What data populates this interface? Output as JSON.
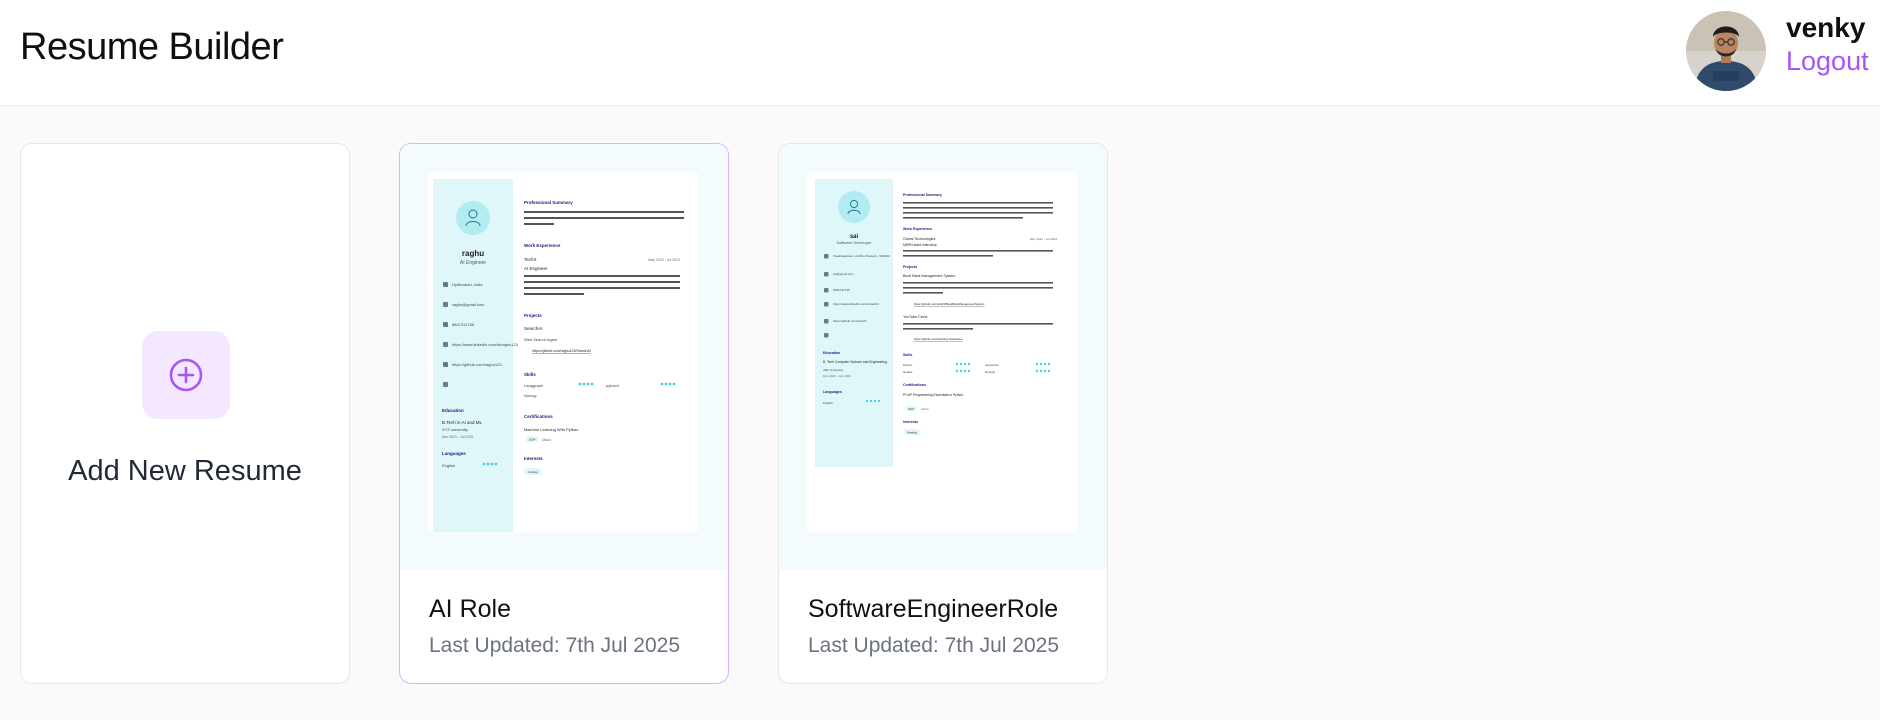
{
  "app": {
    "title": "Resume Builder"
  },
  "user": {
    "name": "venky",
    "logout_label": "Logout",
    "avatar_icon": "user-avatar-photo"
  },
  "add_card": {
    "label": "Add New Resume",
    "icon": "plus-circle-icon"
  },
  "resumes": [
    {
      "title": "AI Role",
      "updated": "Last Updated: 7th Jul 2025",
      "preview": {
        "name": "raghu",
        "role": "AI Engineer",
        "contacts": [
          "Hyderabad, India",
          "raghu@gmail.com",
          "8847311786",
          "https://www.linkedin.com/in/raghu123",
          "https://github.com/raghu123"
        ],
        "summary_heading": "Professional Summary",
        "summary": "AI Developer with hands-on experience in building AI Agents. Completed internships and personal projects demonstrating a strong foundation in AI Developer.",
        "work_heading": "Work Experience",
        "work_company": "TechX",
        "work_dates": "May 2023 - Jul 2023",
        "work_role": "AI Engineer",
        "work_desc": "A Comprehensive TDMs Test Data Management pipeline is created to produce synthetic Tabular Datasets that accurately replicate the characteristics and patterns of real-world data using CTGAN and RealTabFormer libraries",
        "projects_heading": "Projects",
        "project_name": "SearchAI",
        "project_desc": "Web Search Agent",
        "project_link": "https://github.com/raghu123/SearchAI",
        "education_heading": "Education",
        "degree": "B.Tech in AI and ML",
        "school": "XYZ university",
        "edu_dates": "Dec 2021 - Jul 2025",
        "skills_heading": "Skills",
        "skills": [
          "Langgraph",
          "Numpy",
          "pytorch"
        ],
        "languages_heading": "Languages",
        "languages": [
          "English"
        ],
        "cert_heading": "Certifications",
        "cert": "Machine Learning With Python",
        "cert_tag": "2024",
        "cert_org": "Cisco",
        "interests_heading": "Interests",
        "interest": "Coding"
      }
    },
    {
      "title": "SoftwareEngineerRole",
      "updated": "Last Updated: 7th Jul 2025",
      "preview": {
        "name": "sai",
        "role": "Software Developer",
        "contacts": [
          "Visakhapatnam, Andhra Pradesh - 530003",
          "sai@gmail.com",
          "9182737746",
          "https://www.linkedin.com/in/sai123",
          "https://github.com/sai123"
        ],
        "summary_heading": "Professional Summary",
        "summary": "Full-stack web developer with hands-on experience in MERN Stack, passionate about building scalable and user-centric web applications. Completed internships and personal projects demonstrating a strong foundation in both frontend and backend development.",
        "work_heading": "Work Experience",
        "work_company": "Global Technologies",
        "work_dates": "May 2024 - Jul 2024",
        "work_role": "MERN stack internship",
        "work_desc": "During the internship I learn MERN stack technologies and developed a comprehensive E-commerce application",
        "projects_heading": "Projects",
        "project_name": "Book Bank Management System",
        "project_desc": "Application designed to manage libraries in Universities keeping track of books in libraries and simplifying the process of requesting the books for students",
        "project_link": "https://github.com/sai123/BookBankManagementSystem",
        "project2_name": "YouTube Clone",
        "project2_desc": "Developed a responsive web application enabling users to utilize different functionalities of youtube.",
        "project2_link": "https://github.com/sai123/youtubeclone",
        "education_heading": "Education",
        "degree": "B. Tech Computer Science and Engineering",
        "school": "ABC University",
        "edu_dates": "Dec 2020 - Jun 2024",
        "skills_heading": "Skills",
        "skills": [
          "Python",
          "Nodejs",
          "Javascript",
          "Reactjs"
        ],
        "languages_heading": "Languages",
        "languages": [
          "English"
        ],
        "cert_heading": "Certifications",
        "cert": "PCAP Programming Essentials in Python",
        "cert_tag": "2024",
        "cert_org": "Cisco",
        "interests_heading": "Interests",
        "interest": "Reading"
      }
    }
  ],
  "colors": {
    "accent_purple": "#a855f7",
    "accent_purple_soft": "#f3e8ff",
    "resume_sidebar": "#e0f7fa",
    "resume_avatar": "#b2ebf2",
    "skill_dots": "#4dd0e1"
  }
}
